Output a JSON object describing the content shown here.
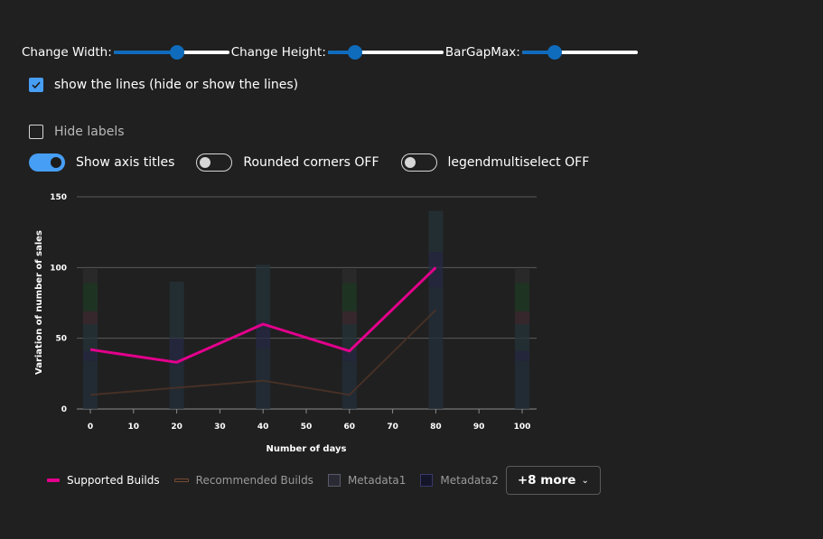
{
  "controls": {
    "sliders": [
      {
        "label": "Change Width:",
        "value": 0.56
      },
      {
        "label": "Change Height:",
        "value": 0.2
      },
      {
        "label": "BarGapMax:",
        "value": 0.25
      }
    ],
    "show_lines_label": "show the lines (hide or show the lines)",
    "show_lines_checked": true,
    "hide_labels_label": "Hide labels",
    "hide_labels_checked": false,
    "toggles": [
      {
        "label": "Show axis titles",
        "on": true
      },
      {
        "label": "Rounded corners OFF",
        "on": false
      },
      {
        "label": "legendmultiselect OFF",
        "on": false
      }
    ]
  },
  "chart_data": {
    "type": "bar",
    "xlabel": "Number of days",
    "ylabel": "Variation of number of sales",
    "xlim": [
      0,
      100
    ],
    "ylim": [
      0,
      150
    ],
    "xticks": [
      0,
      10,
      20,
      30,
      40,
      50,
      60,
      70,
      80,
      90,
      100
    ],
    "yticks": [
      0,
      50,
      100,
      150
    ],
    "grid": true,
    "bar_x": [
      0,
      20,
      40,
      60,
      80,
      100
    ],
    "bar_stacks": [
      [
        {
          "v": 34,
          "c": "#232f3a"
        },
        {
          "v": 7,
          "c": "#252945"
        },
        {
          "v": 19,
          "c": "#243338"
        },
        {
          "v": 9,
          "c": "#3d2a31"
        },
        {
          "v": 20,
          "c": "#1f3a24"
        },
        {
          "v": 10,
          "c": "#2c2c2c"
        }
      ],
      [
        {
          "v": 30,
          "c": "#232f3a"
        },
        {
          "v": 20,
          "c": "#252945"
        },
        {
          "v": 40,
          "c": "#243338"
        }
      ],
      [
        {
          "v": 43,
          "c": "#232f3a"
        },
        {
          "v": 19,
          "c": "#252945"
        },
        {
          "v": 40,
          "c": "#243338"
        }
      ],
      [
        {
          "v": 34,
          "c": "#232f3a"
        },
        {
          "v": 7,
          "c": "#252945"
        },
        {
          "v": 19,
          "c": "#243338"
        },
        {
          "v": 9,
          "c": "#3d2a31"
        },
        {
          "v": 20,
          "c": "#1f3a24"
        },
        {
          "v": 10,
          "c": "#2c2c2c"
        }
      ],
      [
        {
          "v": 86,
          "c": "#232f3a"
        },
        {
          "v": 25,
          "c": "#252945"
        },
        {
          "v": 29,
          "c": "#243338"
        }
      ],
      [
        {
          "v": 34,
          "c": "#232f3a"
        },
        {
          "v": 7,
          "c": "#252945"
        },
        {
          "v": 19,
          "c": "#243338"
        },
        {
          "v": 9,
          "c": "#3d2a31"
        },
        {
          "v": 20,
          "c": "#1f3a24"
        },
        {
          "v": 10,
          "c": "#2c2c2c"
        }
      ]
    ],
    "series": [
      {
        "name": "Supported Builds",
        "color": "#e3008c",
        "x": [
          0,
          20,
          40,
          60,
          80
        ],
        "values": [
          42,
          33,
          60,
          41,
          100
        ]
      },
      {
        "name": "Recommended Builds",
        "color": "#4a3227",
        "x": [
          0,
          20,
          40,
          60,
          80
        ],
        "values": [
          10,
          15,
          20,
          10,
          70
        ]
      }
    ],
    "legend": {
      "items": [
        {
          "name": "Supported Builds",
          "kind": "line",
          "color": "#e3008c",
          "active": true
        },
        {
          "name": "Recommended Builds",
          "kind": "line",
          "color": "#7a4a33",
          "active": false
        },
        {
          "name": "Metadata1",
          "kind": "box",
          "color": "#3a3a4a",
          "active": false
        },
        {
          "name": "Metadata2",
          "kind": "box",
          "color": "#1c1c3a",
          "active": false
        }
      ],
      "more_label": "+8 more"
    }
  }
}
